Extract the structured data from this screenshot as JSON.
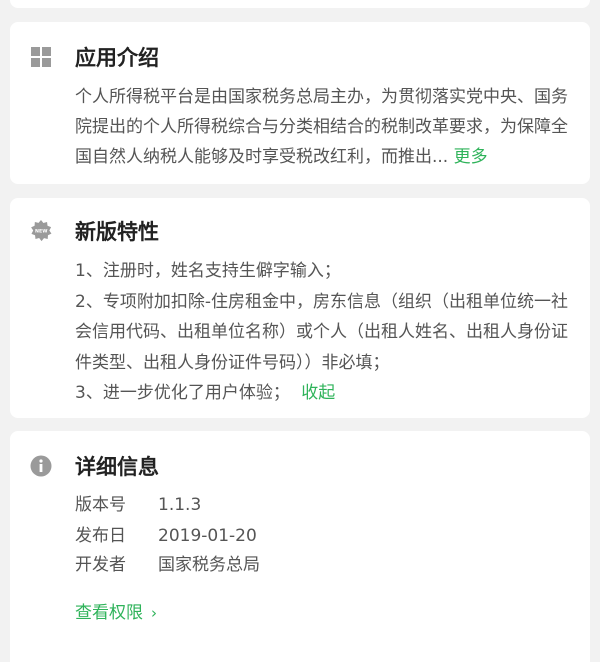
{
  "intro": {
    "title": "应用介绍",
    "icon": "grid-icon",
    "text": "个人所得税平台是由国家税务总局主办，为贯彻落实党中央、国务院提出的个人所得税综合与分类相结合的税制改革要求，为保障全国自然人纳税人能够及时享受税改红利，而推出...",
    "more_label": "更多"
  },
  "new_features": {
    "title": "新版特性",
    "icon": "new-badge-icon",
    "icon_text": "NEW",
    "items": [
      "1、注册时，姓名支持生僻字输入；",
      "2、专项附加扣除-住房租金中，房东信息（组织（出租单位统一社会信用代码、出租单位名称）或个人（出租人姓名、出租人身份证件类型、出租人身份证件号码））非必填；",
      "3、进一步优化了用户体验；"
    ],
    "collapse_label": "收起"
  },
  "details": {
    "title": "详细信息",
    "icon": "info-icon",
    "rows": [
      {
        "key": "版本号",
        "value": "1.1.3"
      },
      {
        "key": "发布日",
        "value": "2019-01-20"
      },
      {
        "key": "开发者",
        "value": "国家税务总局"
      }
    ],
    "permissions_label": "查看权限",
    "chevron": "›"
  },
  "colors": {
    "accent": "#2fb35a",
    "icon_gray": "#9a9a9a",
    "background": "#f2f2f2"
  }
}
